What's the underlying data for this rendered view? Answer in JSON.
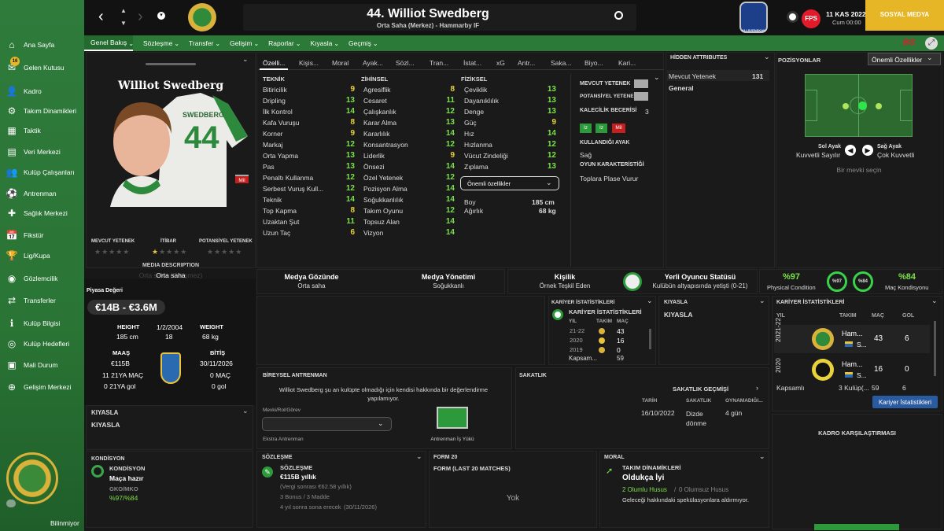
{
  "sidebar": {
    "items": [
      "Ana Sayfa",
      "Gelen Kutusu",
      "Kadro",
      "Takım Dinamikleri",
      "Taktik",
      "Veri Merkezi",
      "Kulüp Çalışanları",
      "Antrenman",
      "Sağlık Merkezi",
      "Fikstür",
      "Lig/Kupa",
      "Gözlemcilik",
      "Transferler",
      "Kulüp Bilgisi",
      "Kulüp Hedefleri",
      "Mali Durum",
      "Gelişim Merkezi"
    ],
    "inbox_badge": "16",
    "footer": "Bilinmiyor"
  },
  "header": {
    "player_title": "44. Williot Swedberg",
    "subtitle": "Orta Saha (Merkez) - Hammarby IF",
    "date": "11 KAS 2022",
    "day": "Cum 00:00",
    "social": "SOSYAL MEDYA",
    "league_badge": "ALLSVENSKAN",
    "bs": "BS"
  },
  "menu": [
    "Genel Bakış",
    "Sözleşme",
    "Transfer",
    "Gelişim",
    "Raporlar",
    "Kıyasla",
    "Geçmiş"
  ],
  "profile": {
    "name": "Williot Swedberg",
    "shirt_name": "SWEDBERG",
    "shirt_number": "44",
    "tag": "Mil",
    "labels": [
      "MEVCUT YETENEK",
      "İTİBAR",
      "POTANSİYEL YETENEK"
    ],
    "media_label": "MEDIA DESCRIPTION",
    "media_value": "Orta saha",
    "media_ghost": "Orta saha (Gelişmez)",
    "value_label": "Piyasa Değeri",
    "value": "€14B - €3.6M",
    "height_label": "HEIGHT",
    "height": "185 cm",
    "dob": "1/2/2004",
    "age": "18",
    "weight_label": "WEIGHT",
    "weight": "68 kg",
    "wage_label": "MAAŞ",
    "wage": "€115B",
    "end_label": "BİTİŞ",
    "end": "30/11/2026",
    "caps": "11 21YA MAÇ",
    "goals": "0 21YA gol",
    "caps2": "0 MAÇ",
    "goals2": "0 gol"
  },
  "tabs": [
    "Özelli...",
    "Kişis...",
    "Moral",
    "Ayak...",
    "Sözl...",
    "Tran...",
    "İstat...",
    "xG",
    "Antr...",
    "Saka...",
    "Biyo...",
    "Kari..."
  ],
  "attrs": {
    "technical_title": "TEKNİK",
    "mental_title": "ZİHİNSEL",
    "physical_title": "FİZİKSEL",
    "technical": [
      [
        "Bitiricilik",
        "9"
      ],
      [
        "Dripling",
        "13"
      ],
      [
        "İlk Kontrol",
        "14"
      ],
      [
        "Kafa Vuruşu",
        "8"
      ],
      [
        "Korner",
        "9"
      ],
      [
        "Markaj",
        "12"
      ],
      [
        "Orta Yapma",
        "13"
      ],
      [
        "Pas",
        "13"
      ],
      [
        "Penaltı Kullanma",
        "12"
      ],
      [
        "Serbest Vuruş Kull...",
        "12"
      ],
      [
        "Teknik",
        "14"
      ],
      [
        "Top Kapma",
        "8"
      ],
      [
        "Uzaktan Şut",
        "11"
      ],
      [
        "Uzun Taç",
        "6"
      ]
    ],
    "mental": [
      [
        "Agresiflik",
        "8"
      ],
      [
        "Cesaret",
        "11"
      ],
      [
        "Çalışkanlık",
        "12"
      ],
      [
        "Karar Alma",
        "13"
      ],
      [
        "Kararlılık",
        "14"
      ],
      [
        "Konsantrasyon",
        "12"
      ],
      [
        "Liderlik",
        "9"
      ],
      [
        "Önsezi",
        "14"
      ],
      [
        "Özel Yetenek",
        "12"
      ],
      [
        "Pozisyon Alma",
        "14"
      ],
      [
        "Soğukkanlılık",
        "14"
      ],
      [
        "Takım Oyunu",
        "12"
      ],
      [
        "Topsuz Alan",
        "14"
      ],
      [
        "Vizyon",
        "14"
      ]
    ],
    "physical": [
      [
        "Çeviklik",
        "13"
      ],
      [
        "Dayanıklılık",
        "13"
      ],
      [
        "Denge",
        "13"
      ],
      [
        "Güç",
        "9"
      ],
      [
        "Hız",
        "14"
      ],
      [
        "Hızlanma",
        "12"
      ],
      [
        "Vücut Zindeliği",
        "12"
      ],
      [
        "Zıplama",
        "13"
      ]
    ],
    "dropdown": "Önemli özellikler",
    "boy_label": "Boy",
    "boy": "185 cm",
    "agirlik_label": "Ağırlık",
    "agirlik": "68 kg"
  },
  "ability": {
    "cur": "MEVCUT YETENEK",
    "pot": "POTANSİYEL YETENEK",
    "kal": "KALECİLİK BECERİSİ",
    "kal_val": "3",
    "chips": [
      "Iz",
      "Iz",
      "Mil"
    ],
    "foot_label": "KULLANDIĞI AYAK",
    "foot": "Sağ",
    "char_label": "OYUN KARAKTERİSTİĞİ",
    "char": "Toplara Plase Vurur"
  },
  "hidden": {
    "title": "HİDDEN ATTRIBUTES",
    "row": "Mevcut Yetenek",
    "row_val": "131",
    "sub": "General"
  },
  "positions": {
    "title": "POZİSYONLAR",
    "select": "Önemli Özellikler",
    "left_label": "Sol Ayak",
    "left_val": "Kuvvetli Sayılır",
    "right_label": "Sağ Ayak",
    "right_val": "Çok Kuvvetli",
    "hint": "Bir mevki seçin"
  },
  "info": {
    "media_title": "Medya Gözünde",
    "media_val": "Orta saha",
    "mgmt_title": "Medya Yönetimi",
    "mgmt_val": "Soğukkanlı",
    "pers_title": "Kişilik",
    "pers_val": "Örnek Teşkil Eden",
    "local_title": "Yerli Oyuncu Statüsü",
    "local_val": "Kulübün altyapısında yetişti (0-21)",
    "pc": "%97",
    "pc_label": "Physical Condition",
    "mk": "%84",
    "mk_label": "Maç Kondisyonu",
    "ring1": "%97",
    "ring2": "%84"
  },
  "career_small": {
    "title": "KARİYER İSTATİSTİKLERİ",
    "sub": "KARİYER İSTATİSTİKLERİ",
    "cols": [
      "YIL",
      "TAKIM",
      "MAÇ"
    ],
    "rows": [
      [
        "21-22",
        "43"
      ],
      [
        "2020",
        "16"
      ],
      [
        "2019",
        "0"
      ]
    ],
    "footer": "Kapsam...",
    "footer_val": "59"
  },
  "kiyasla_small": {
    "title": "KIYASLA",
    "sub": "KIYASLA"
  },
  "career_big": {
    "title": "KARİYER İSTATİSTİKLERİ",
    "cols": [
      "YIL",
      "TAKIM",
      "MAÇ",
      "GOL"
    ],
    "rows": [
      [
        "2021-22",
        "Ham...",
        "S...",
        "43",
        "6"
      ],
      [
        "2020",
        "Ham...",
        "S...",
        "16",
        "0"
      ]
    ],
    "foot": "Kapsamlı",
    "foot_club": "3 Kulüp(...",
    "foot_m": "59",
    "foot_g": "6",
    "button": "Kariyer İstatistikleri"
  },
  "training": {
    "title": "BİREYSEL ANTRENMAN",
    "text": "Williot Swedberg şu an kulüpte olmadığı için kendisi hakkında bir değerlendirme yapılamıyor.",
    "field_label": "Mevki/Rol/Görev",
    "extra": "Ekstra Antrenman",
    "load": "Antrenman İş Yükü"
  },
  "injury": {
    "title": "SAKATLIK",
    "sub": "SAKATLIK GEÇMİŞİ",
    "cols": [
      "TARİH",
      "SAKATLIK",
      "OYNAMADIĞI..."
    ],
    "date": "16/10/2022",
    "injury": "Dizde dönme",
    "out": "4 gün"
  },
  "squad_cmp": {
    "title": "KADRO KARŞILAŞTIRMASI"
  },
  "kiyasla_left": {
    "title": "KIYASLA",
    "sub": "KIYASLA"
  },
  "condition": {
    "title": "KONDİSYON",
    "sub": "KONDİSYON",
    "val": "Maça hazır",
    "gko": "GKO/MKO",
    "gko_val": "%97/%84"
  },
  "contract": {
    "title": "SÖZLEŞME",
    "sub": "SÖZLEŞME",
    "wage": "€115B yıllık",
    "after": "(Vergi sonrası €62.58 yıllık)",
    "bonus": "3 Bonus / 3 Madde",
    "ends": "4 yıl sonra sona erecek",
    "ends_date": "(30/11/2026)"
  },
  "form": {
    "title": "FORM 20",
    "sub": "FORM (LAST 20 MATCHES)",
    "val": "Yok"
  },
  "moral": {
    "title": "MORAL",
    "sub": "TAKIM DİNAMİKLERİ",
    "val": "Oldukça İyi",
    "pos": "2 Olumlu Husus",
    "neg": "0 Olumsuz Husus",
    "text": "Geleceği hakkındaki spekülasyonlara aldırmıyor."
  }
}
